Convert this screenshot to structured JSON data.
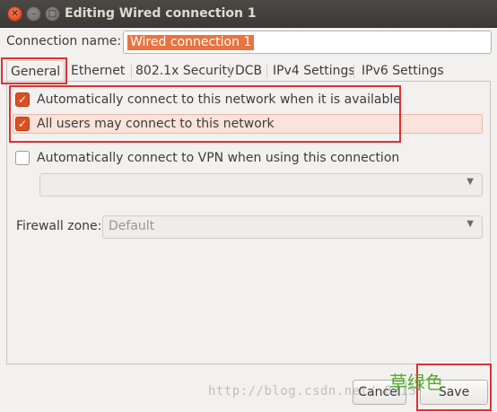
{
  "window": {
    "title": "Editing Wired connection 1",
    "buttons": {
      "close": "✕",
      "minimize": "–",
      "maximize": "□"
    }
  },
  "connection_name": {
    "label": "Connection name:",
    "value": "Wired connection 1"
  },
  "tabs": [
    {
      "label": "General",
      "active": true
    },
    {
      "label": "Ethernet"
    },
    {
      "label": "802.1x Security"
    },
    {
      "label": "DCB"
    },
    {
      "label": "IPv4 Settings"
    },
    {
      "label": "IPv6 Settings"
    }
  ],
  "general": {
    "auto_connect": {
      "label": "Automatically connect to this network when it is available",
      "checked": true
    },
    "all_users": {
      "label": "All users may connect to this network",
      "checked": true
    },
    "auto_vpn": {
      "label": "Automatically connect to VPN when using this connection",
      "checked": false
    },
    "vpn_select": {
      "value": ""
    },
    "firewall": {
      "label": "Firewall zone:",
      "value": "Default"
    }
  },
  "footer": {
    "cancel_label": "Cancel",
    "save_label": "Save"
  },
  "annotations": {
    "note": "草绿色",
    "watermark": "http://blog.csdn.net/ 8313"
  },
  "colors": {
    "accent": "#dd4e20",
    "selection": "#e9733e",
    "annotation_red": "#e03030",
    "annotation_green": "#4fae2a"
  }
}
